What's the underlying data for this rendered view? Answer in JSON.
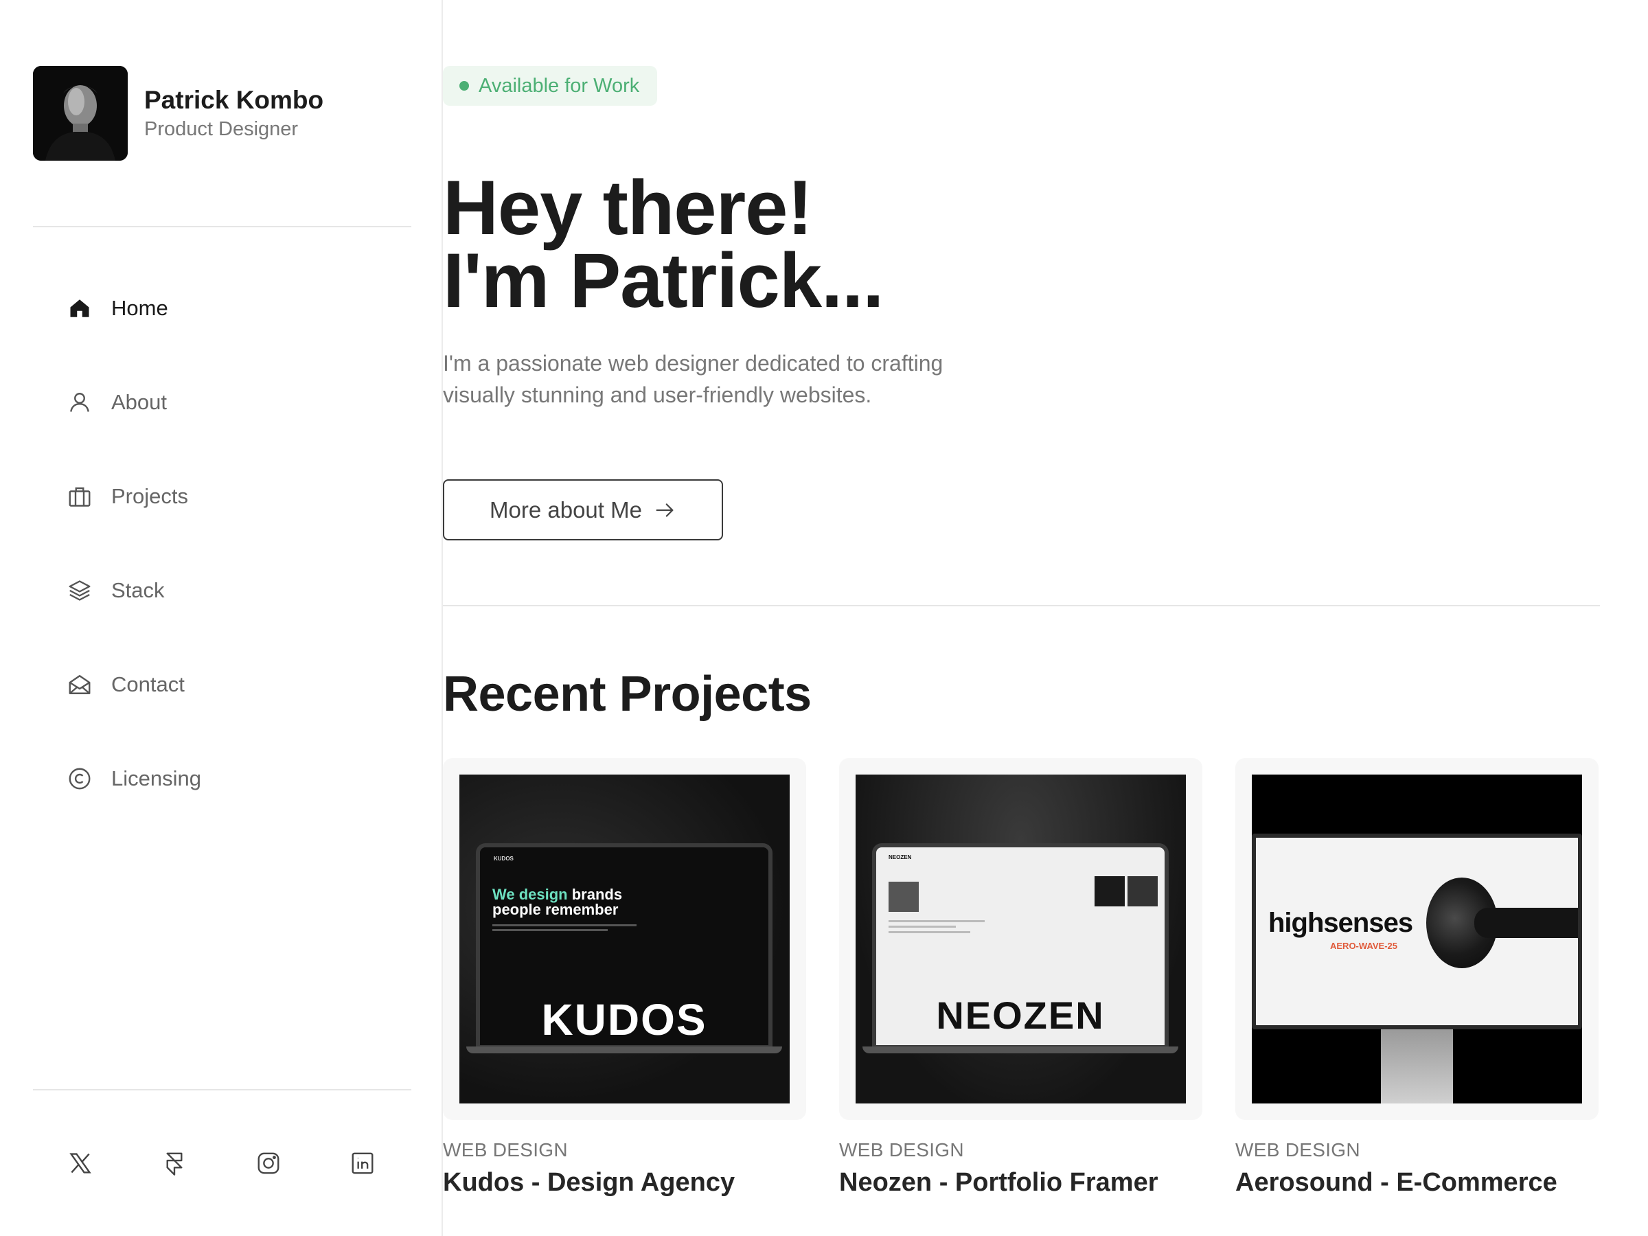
{
  "profile": {
    "name": "Patrick Kombo",
    "role": "Product Designer"
  },
  "nav": {
    "items": [
      {
        "label": "Home",
        "icon": "home-icon",
        "active": true
      },
      {
        "label": "About",
        "icon": "user-icon"
      },
      {
        "label": "Projects",
        "icon": "briefcase-icon"
      },
      {
        "label": "Stack",
        "icon": "layers-icon"
      },
      {
        "label": "Contact",
        "icon": "mail-open-icon"
      },
      {
        "label": "Licensing",
        "icon": "copyright-icon"
      }
    ]
  },
  "socials": [
    {
      "icon": "x-twitter-icon"
    },
    {
      "icon": "framer-icon"
    },
    {
      "icon": "instagram-icon"
    },
    {
      "icon": "linkedin-icon"
    }
  ],
  "hero": {
    "badge": "Available for Work",
    "title_line1": "Hey there!",
    "title_line2": "I'm Patrick...",
    "subtitle": "I'm  a passionate web designer dedicated to crafting visually stunning and user-friendly websites.",
    "button_label": "More about Me"
  },
  "recent": {
    "title": "Recent Projects",
    "projects": [
      {
        "category": "WEB DESIGN",
        "title": "Kudos - Design Agency",
        "thumb_headline_1": "We design",
        "thumb_headline_2": " brands",
        "thumb_headline_3": "people remember",
        "thumb_nav": "KUDOS",
        "thumb_word": "KUDOS"
      },
      {
        "category": "WEB DESIGN",
        "title": "Neozen - Portfolio Framer",
        "thumb_nav": "NEOZEN",
        "thumb_word": "NEOZEN"
      },
      {
        "category": "WEB DESIGN",
        "title": "Aerosound - E-Commerce",
        "thumb_word": "highsenses",
        "thumb_sub": "AERO-WAVE-25"
      }
    ]
  },
  "colors": {
    "accent_green": "#4caf74",
    "badge_bg": "#eef7f0",
    "kudos_accent": "#6de0c0",
    "aero_accent": "#e05a3a"
  }
}
